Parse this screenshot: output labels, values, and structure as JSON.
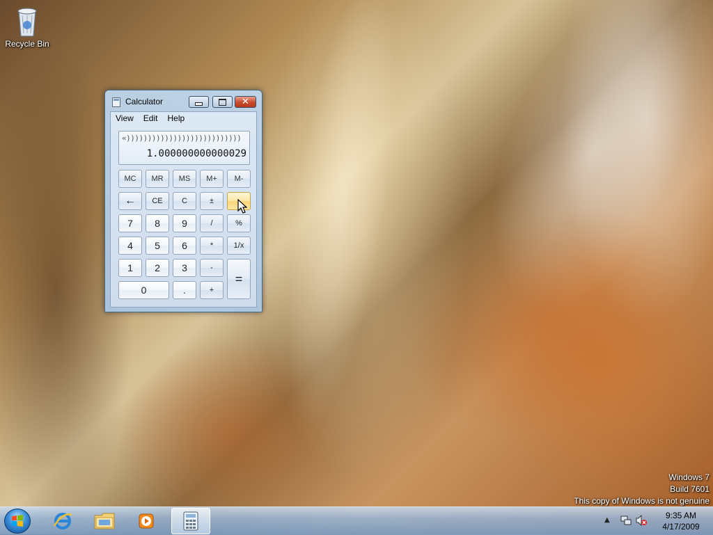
{
  "desktop": {
    "icons": [
      {
        "label": "Recycle Bin",
        "icon": "recycle-bin-icon"
      }
    ],
    "watermark": {
      "line1": "Windows 7",
      "line2": "Build 7601",
      "line3": "This copy of Windows is not genuine"
    }
  },
  "calculator": {
    "title": "Calculator",
    "menu": [
      "View",
      "Edit",
      "Help"
    ],
    "display": {
      "history": "«)))))))))))))))))))))))))))",
      "value": "1.000000000000029"
    },
    "memory_keys": [
      "MC",
      "MR",
      "MS",
      "M+",
      "M-"
    ],
    "row2": [
      "←",
      "CE",
      "C",
      "±",
      "√"
    ],
    "row3": [
      "7",
      "8",
      "9",
      "/",
      "%"
    ],
    "row4": [
      "4",
      "5",
      "6",
      "*",
      "1/x"
    ],
    "row5": [
      "1",
      "2",
      "3",
      "-",
      "="
    ],
    "row6": [
      "0",
      ".",
      "+"
    ]
  },
  "taskbar": {
    "pinned": [
      "internet-explorer-icon",
      "windows-explorer-icon",
      "media-player-icon",
      "calculator-icon"
    ],
    "active": "calculator-icon",
    "clock": {
      "time": "9:35 AM",
      "date": "4/17/2009"
    }
  },
  "colors": {
    "taskbar": "#9bb7d6",
    "hot_key": "#fbd57a",
    "close_button": "#c84a2c"
  }
}
